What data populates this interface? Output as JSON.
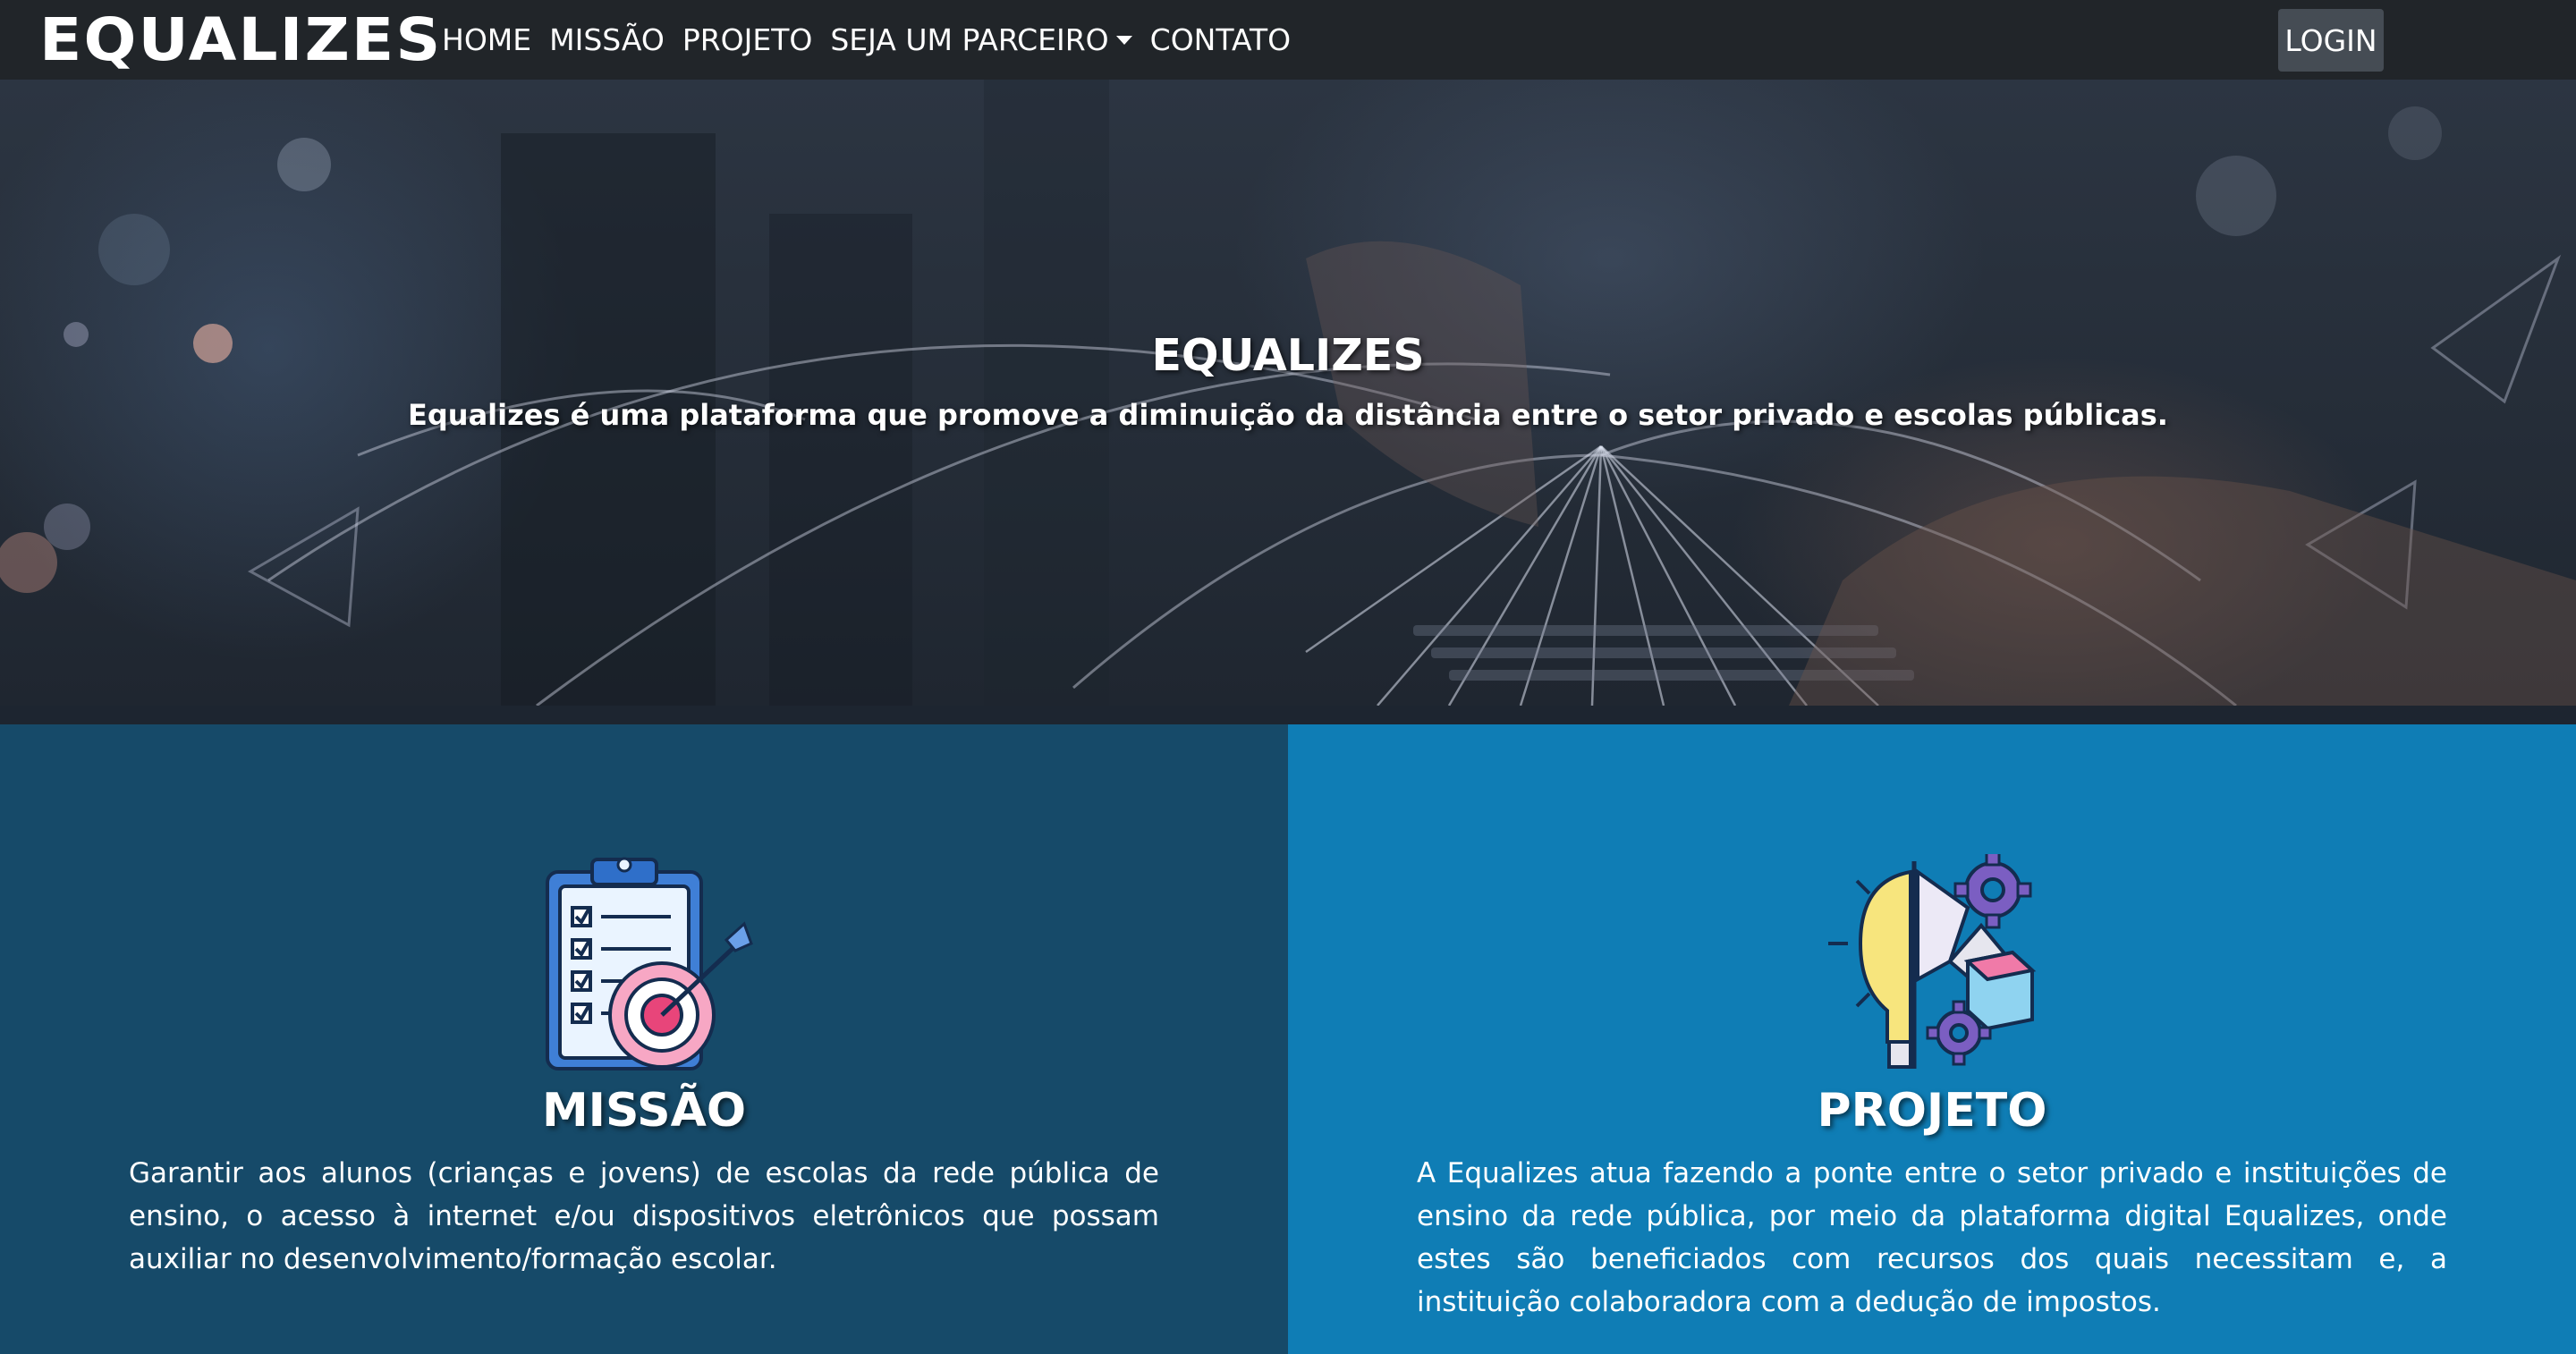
{
  "navbar": {
    "brand": "EQUALIZES",
    "links": [
      "HOME",
      "MISSÃO",
      "PROJETO",
      "SEJA UM PARCEIRO",
      "CONTATO"
    ],
    "login_label": "LOGIN"
  },
  "hero": {
    "title": "EQUALIZES",
    "subtitle": "Equalizes é uma plataforma que promove a diminuição da distância entre o setor privado e escolas públicas."
  },
  "mission": {
    "icon": "clipboard-target-icon",
    "title": "MISSÃO",
    "text": "Garantir aos alunos (crianças e jovens) de escolas da rede pública de ensino, o acesso à internet e/ou dispositivos eletrônicos que possam auxiliar no desenvolvimento/formação escolar."
  },
  "project": {
    "icon": "lightbulb-gears-icon",
    "title": "PROJETO",
    "text": "A Equalizes atua fazendo a ponte entre o setor privado e instituições de ensino da rede pública, por meio da plataforma digital Equalizes, onde estes são beneficiados com recursos dos quais necessitam e, a instituição colaboradora com a dedução de impostos."
  },
  "colors": {
    "navbar": "#212529",
    "login_button": "#454c54",
    "mission_bg": "#164a69",
    "project_bg": "#0f7db5"
  }
}
